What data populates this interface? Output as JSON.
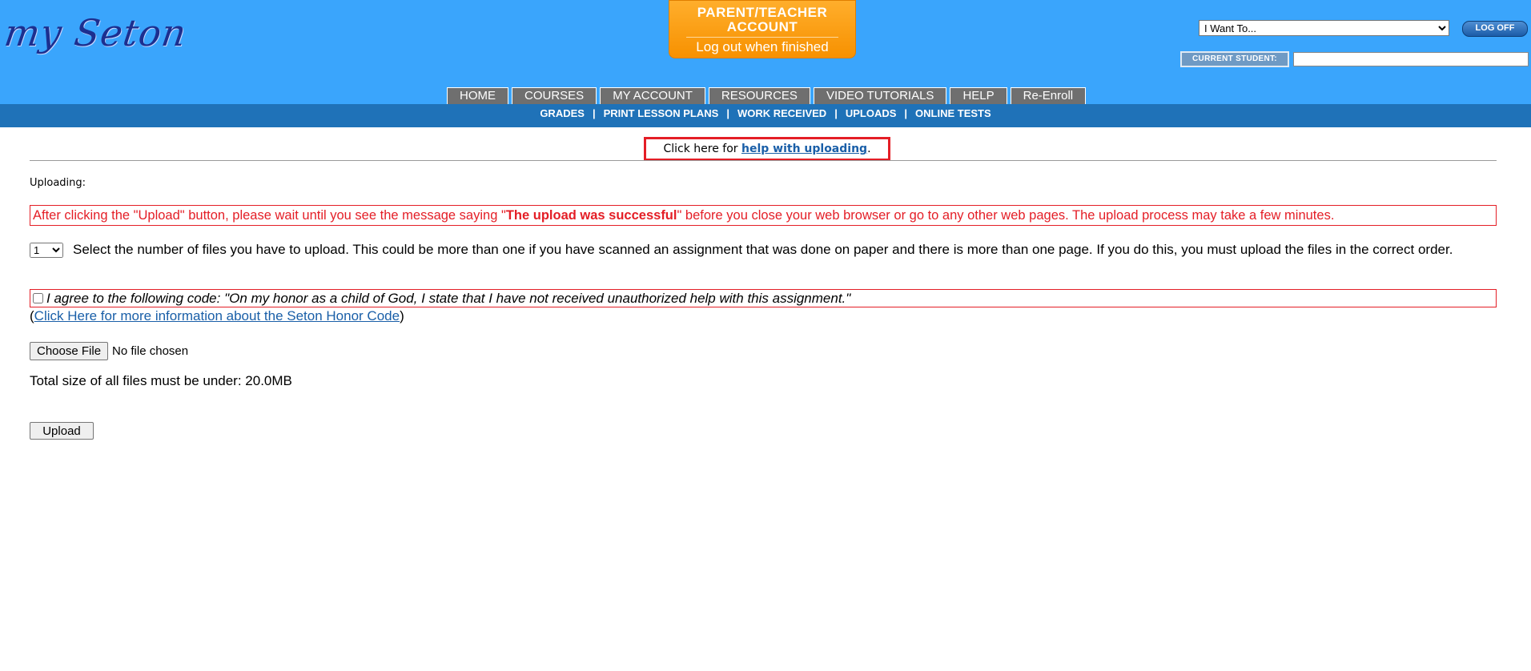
{
  "header": {
    "logo_text": "my Seton",
    "badge_title_line1": "PARENT/TEACHER",
    "badge_title_line2": "ACCOUNT",
    "badge_subtitle": "Log out when finished",
    "iwant_selected": "I Want To...",
    "logoff_label": "LOG OFF",
    "current_student_label": "CURRENT STUDENT:",
    "current_student_value": ""
  },
  "main_nav": {
    "items": [
      {
        "label": "HOME"
      },
      {
        "label": "COURSES"
      },
      {
        "label": "MY ACCOUNT"
      },
      {
        "label": "RESOURCES"
      },
      {
        "label": "VIDEO TUTORIALS"
      },
      {
        "label": "HELP"
      },
      {
        "label": "Re-Enroll"
      }
    ]
  },
  "sub_nav": {
    "items": [
      {
        "label": "GRADES"
      },
      {
        "label": "PRINT LESSON PLANS"
      },
      {
        "label": "WORK RECEIVED"
      },
      {
        "label": "UPLOADS"
      },
      {
        "label": "ONLINE TESTS"
      }
    ],
    "separator": "|"
  },
  "help": {
    "prefix": "Click here for ",
    "link_text": "help with uploading",
    "suffix": "."
  },
  "uploading_label": "Uploading:",
  "warning": {
    "part1": "After clicking the \"Upload\" button, please wait until you see the message saying \"",
    "bold": "The upload was successful",
    "part2": "\" before you close your web browser or go to any other web pages.  The upload process may take a few minutes."
  },
  "files": {
    "count_selected": "1",
    "instructions": "Select the number of files you have to upload.  This could be more than one if you have scanned an assignment that was done on paper and there is more than one page.  If you do this, you must upload the files in the correct order."
  },
  "honor": {
    "statement": "I agree to the following code: \"On my honor as a child of God, I state that I have not received unauthorized help with this assignment.\"",
    "checked": false,
    "link_open": "(",
    "link_text": "Click Here for more information about the Seton Honor Code",
    "link_close": ")"
  },
  "file_input": {
    "button_label": "Choose File",
    "status": "No file chosen"
  },
  "size_note": "Total size of all files must be under: 20.0MB",
  "upload_label": "Upload",
  "colors": {
    "header_bg": "#3aa5fc",
    "subnav_bg": "#1f72b8",
    "badge_orange": "#f79100",
    "alert_red": "#e41e26",
    "link_blue": "#1a5fa8"
  }
}
